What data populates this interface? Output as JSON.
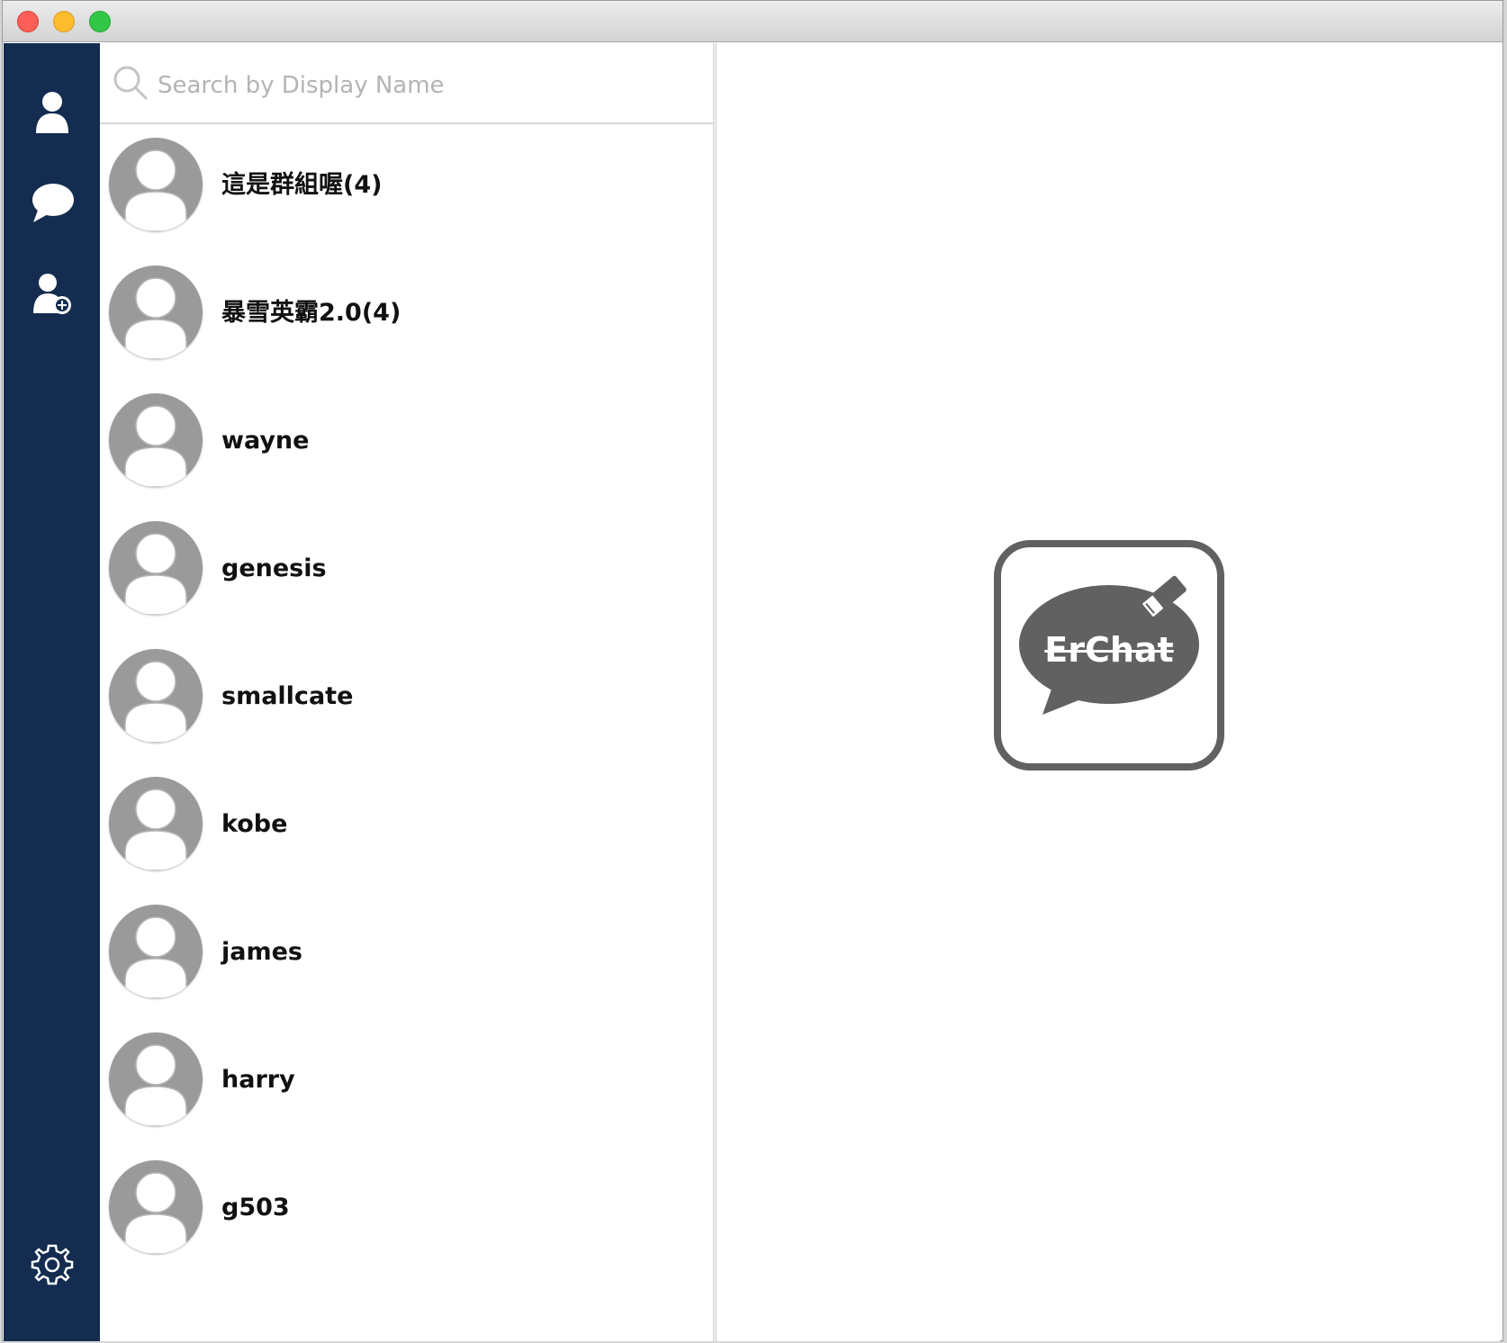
{
  "window": {
    "controls": [
      "close",
      "minimize",
      "maximize"
    ]
  },
  "sidebar": {
    "background": "#132c4f",
    "items": [
      {
        "name": "contacts",
        "icon": "person-icon",
        "active": true
      },
      {
        "name": "chats",
        "icon": "chat-bubble-icon",
        "active": false
      },
      {
        "name": "add-contact",
        "icon": "add-person-icon",
        "active": false
      }
    ],
    "settings_icon": "gear-icon"
  },
  "search": {
    "placeholder": "Search by Display Name",
    "value": ""
  },
  "contacts": [
    {
      "name": "這是群組喔(4)"
    },
    {
      "name": "暴雪英霸2.0(4)"
    },
    {
      "name": "wayne"
    },
    {
      "name": "genesis"
    },
    {
      "name": "smallcate"
    },
    {
      "name": "kobe"
    },
    {
      "name": "james"
    },
    {
      "name": "harry"
    },
    {
      "name": "g503"
    }
  ],
  "detail": {
    "logo_text": "ErChat",
    "logo_color": "#616161"
  }
}
